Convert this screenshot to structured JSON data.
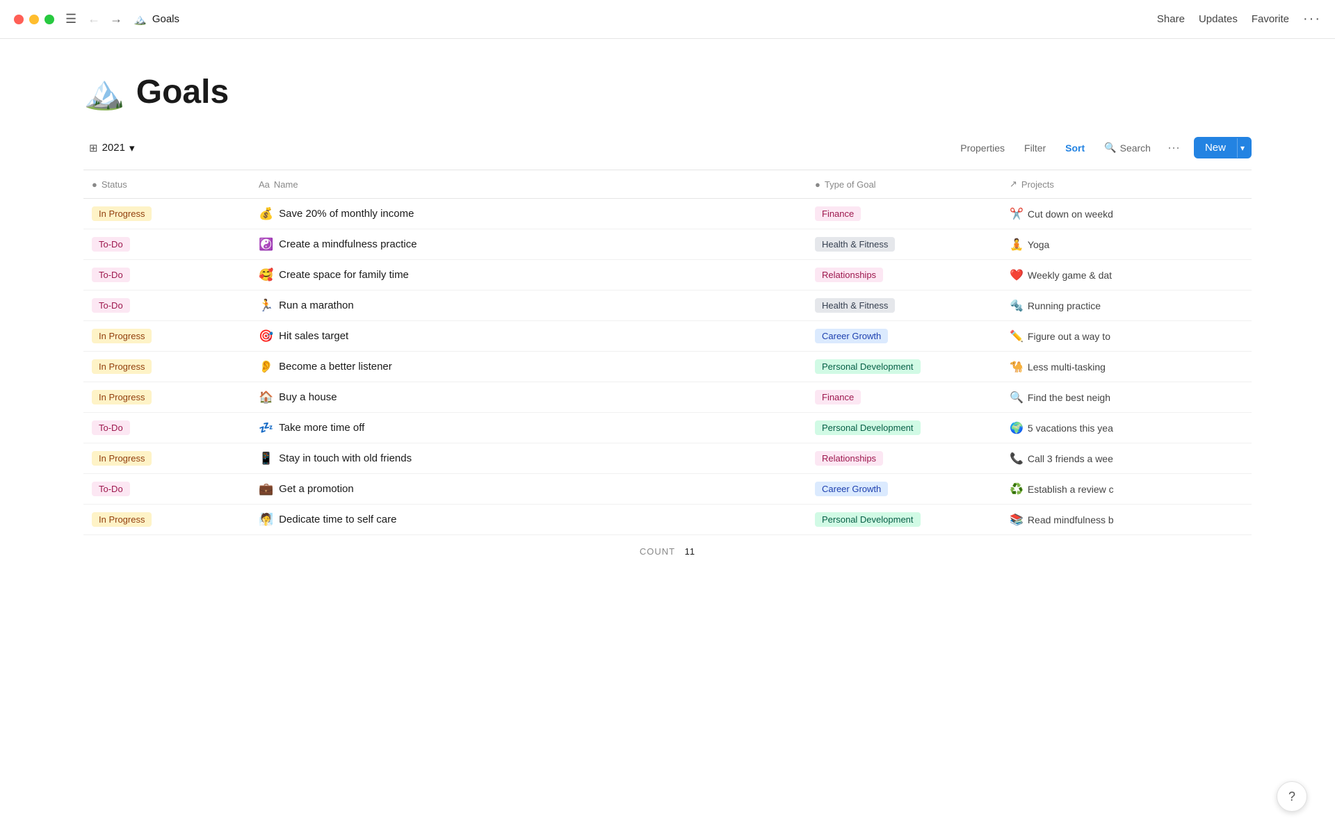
{
  "titlebar": {
    "page_icon": "🏔️",
    "page_title": "Goals",
    "nav_back": "←",
    "nav_forward": "→",
    "share_label": "Share",
    "updates_label": "Updates",
    "favorite_label": "Favorite",
    "more_label": "···"
  },
  "toolbar": {
    "view_icon": "⊞",
    "view_label": "2021",
    "view_caret": "▾",
    "properties_label": "Properties",
    "filter_label": "Filter",
    "sort_label": "Sort",
    "search_label": "Search",
    "new_label": "New",
    "new_caret": "▾"
  },
  "table": {
    "columns": [
      {
        "icon": "●",
        "label": "Status"
      },
      {
        "icon": "Aa",
        "label": "Name"
      },
      {
        "icon": "●",
        "label": "Type of Goal"
      },
      {
        "icon": "↗",
        "label": "Projects"
      }
    ],
    "rows": [
      {
        "status": "In Progress",
        "status_type": "inprogress",
        "emoji": "💰",
        "name": "Save 20% of monthly income",
        "type": "Finance",
        "type_class": "type-finance",
        "project_emoji": "✂️",
        "project": "Cut down on weekd"
      },
      {
        "status": "To-Do",
        "status_type": "todo",
        "emoji": "☯️",
        "name": "Create a mindfulness practice",
        "type": "Health & Fitness",
        "type_class": "type-health",
        "project_emoji": "🧘",
        "project": "Yoga"
      },
      {
        "status": "To-Do",
        "status_type": "todo",
        "emoji": "🥰",
        "name": "Create space for family time",
        "type": "Relationships",
        "type_class": "type-relationships",
        "project_emoji": "❤️",
        "project": "Weekly game & dat"
      },
      {
        "status": "To-Do",
        "status_type": "todo",
        "emoji": "🏃",
        "name": "Run a marathon",
        "type": "Health & Fitness",
        "type_class": "type-health",
        "project_emoji": "🔩",
        "project": "Running practice"
      },
      {
        "status": "In Progress",
        "status_type": "inprogress",
        "emoji": "🎯",
        "name": "Hit sales target",
        "type": "Career Growth",
        "type_class": "type-career",
        "project_emoji": "✏️",
        "project": "Figure out a way to"
      },
      {
        "status": "In Progress",
        "status_type": "inprogress",
        "emoji": "👂",
        "name": "Become a better listener",
        "type": "Personal Development",
        "type_class": "type-personal",
        "project_emoji": "🐪",
        "project": "Less multi-tasking"
      },
      {
        "status": "In Progress",
        "status_type": "inprogress",
        "emoji": "🏠",
        "name": "Buy a house",
        "type": "Finance",
        "type_class": "type-finance",
        "project_emoji": "🔍",
        "project": "Find the best neigh"
      },
      {
        "status": "To-Do",
        "status_type": "todo",
        "emoji": "💤",
        "name": "Take more time off",
        "type": "Personal Development",
        "type_class": "type-personal",
        "project_emoji": "🌍",
        "project": "5 vacations this yea"
      },
      {
        "status": "In Progress",
        "status_type": "inprogress",
        "emoji": "📱",
        "name": "Stay in touch with old friends",
        "type": "Relationships",
        "type_class": "type-relationships",
        "project_emoji": "📞",
        "project": "Call 3 friends a wee"
      },
      {
        "status": "To-Do",
        "status_type": "todo",
        "emoji": "💼",
        "name": "Get a promotion",
        "type": "Career Growth",
        "type_class": "type-career",
        "project_emoji": "♻️",
        "project": "Establish a review c"
      },
      {
        "status": "In Progress",
        "status_type": "inprogress",
        "emoji": "🧖",
        "name": "Dedicate time to self care",
        "type": "Personal Development",
        "type_class": "type-personal",
        "project_emoji": "📚",
        "project": "Read mindfulness b"
      }
    ],
    "count_label": "COUNT",
    "count_value": "11"
  },
  "help": {
    "label": "?"
  }
}
